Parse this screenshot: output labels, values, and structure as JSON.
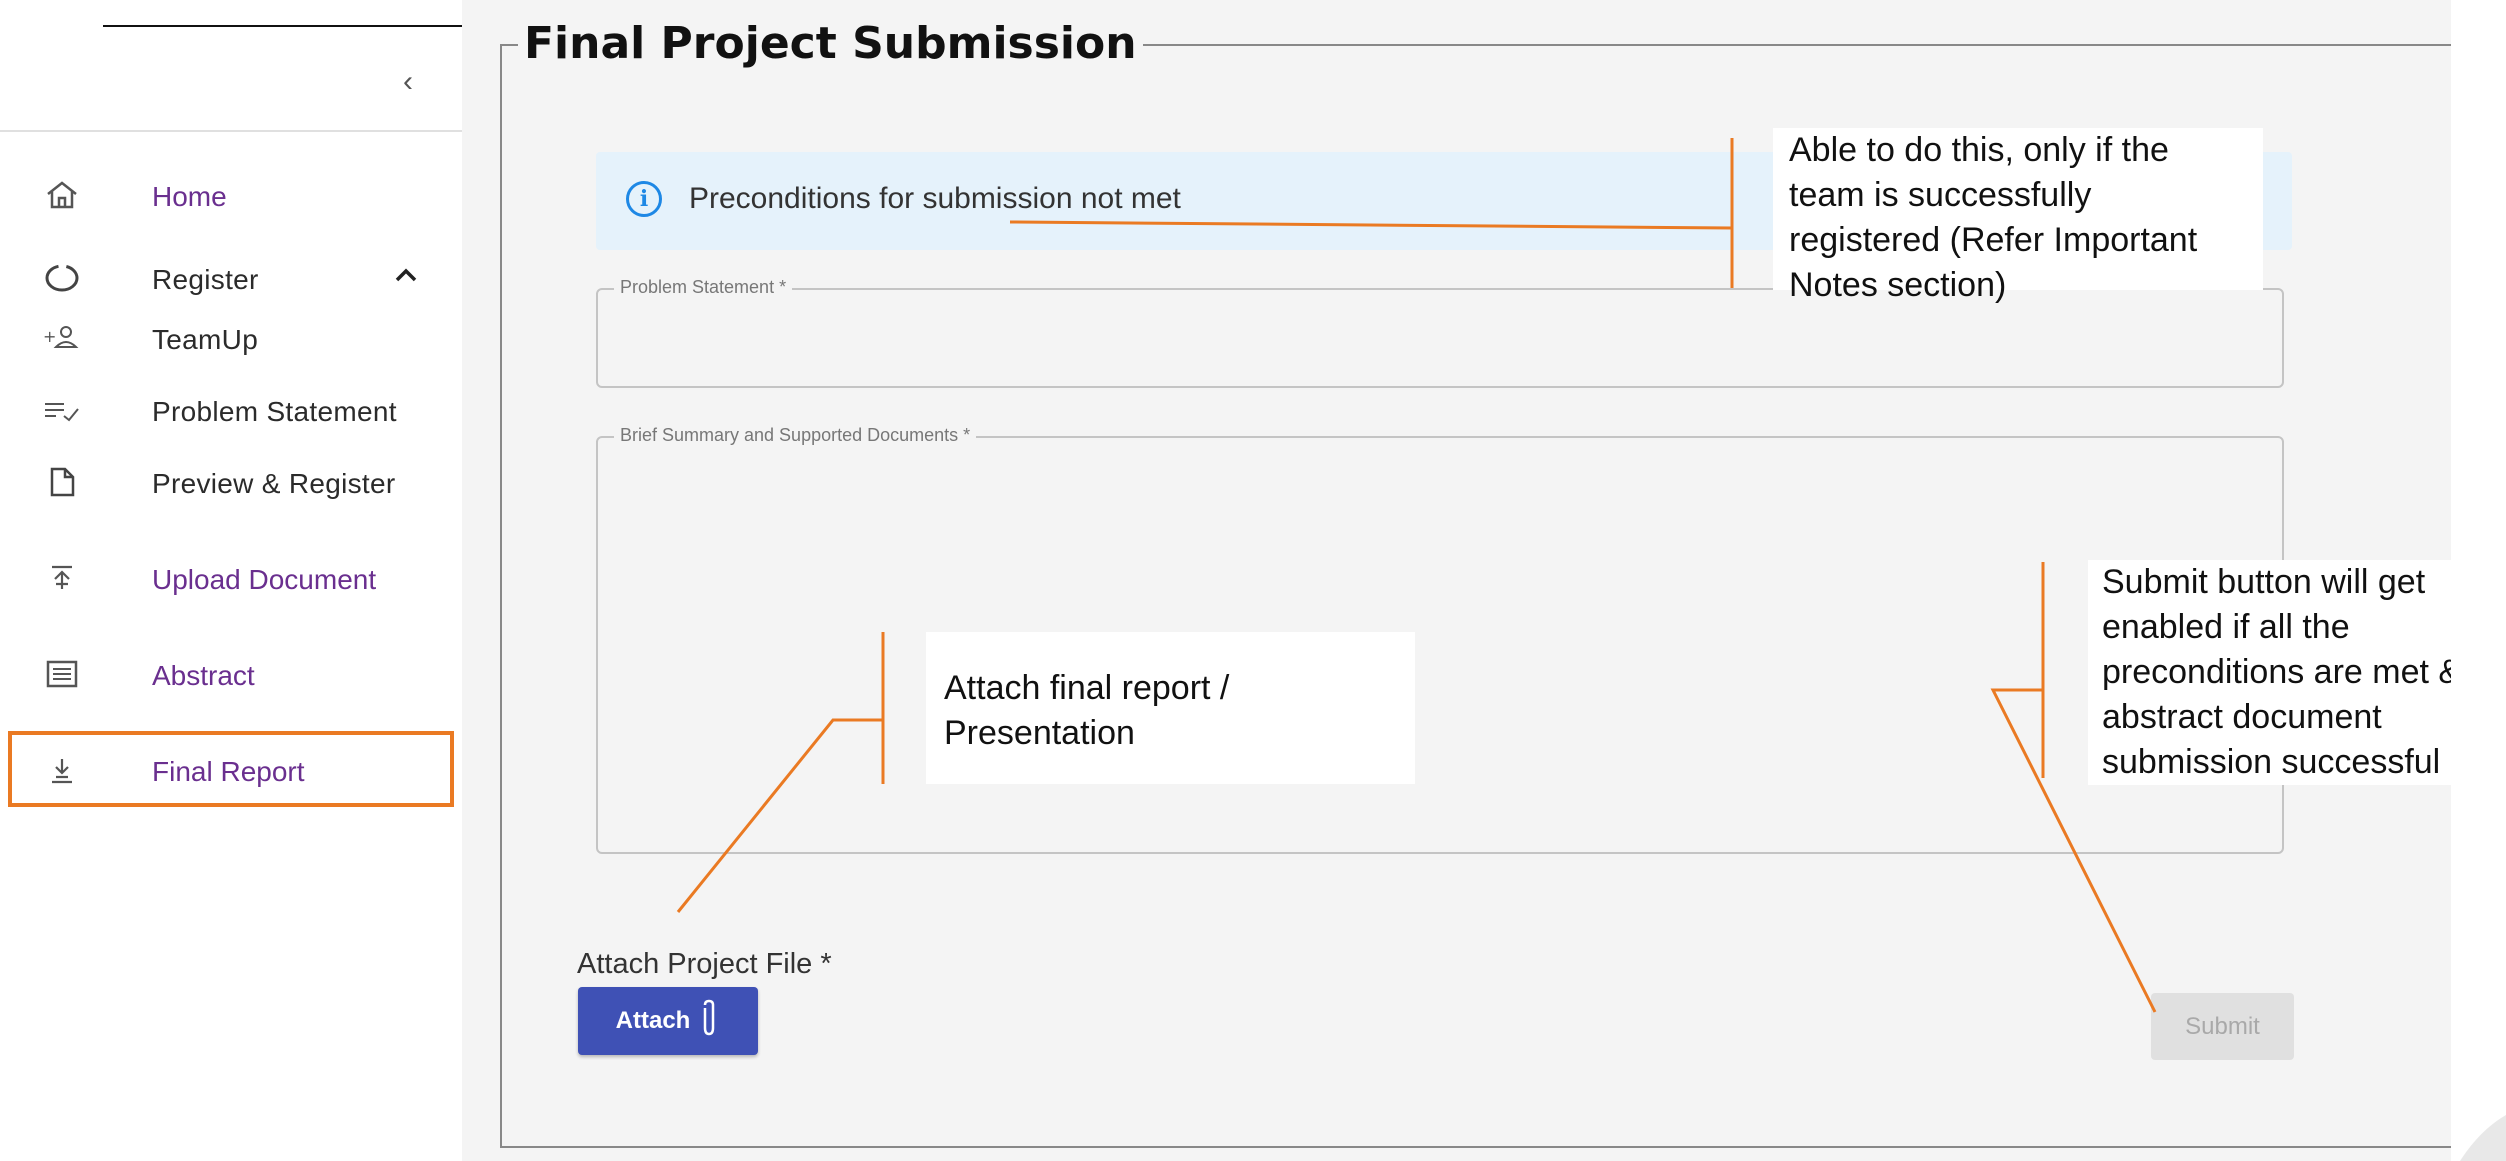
{
  "sidebar": {
    "collapse_icon": "chevron-left-icon",
    "items": [
      {
        "label": "Home",
        "icon": "home-icon"
      },
      {
        "label": "Register",
        "icon": "circle-icon"
      },
      {
        "label": "TeamUp",
        "icon": "add-person-icon"
      },
      {
        "label": "Problem Statement",
        "icon": "list-check-icon"
      },
      {
        "label": "Preview & Register",
        "icon": "document-icon"
      },
      {
        "label": "Upload Document",
        "icon": "upload-icon"
      },
      {
        "label": "Abstract",
        "icon": "article-icon"
      },
      {
        "label": "Final Report",
        "icon": "download-icon"
      }
    ]
  },
  "main": {
    "title": "Final Project Submission",
    "alert": {
      "text": "Preconditions for submission not met",
      "icon": "info-icon"
    },
    "problem_statement_label": "Problem Statement *",
    "summary_label": "Brief Summary and Supported Documents *",
    "attach_caption": "Attach Project File *",
    "attach_button": "Attach",
    "submit_button": "Submit"
  },
  "annotations": {
    "precondition_note": [
      "Able to do this, only if the",
      "team is successfully",
      "registered (Refer Important",
      "Notes section)"
    ],
    "attach_note": [
      "Attach final report /",
      "Presentation"
    ],
    "submit_note": [
      "Submit button will get",
      "enabled if all the",
      "preconditions are met &",
      "abstract document",
      "submission successful"
    ]
  },
  "colors": {
    "accent_purple": "#6a2f8f",
    "attach_blue": "#3f51b5",
    "annotation_orange": "#ea7a23",
    "alert_bg": "#e5f2fb"
  }
}
